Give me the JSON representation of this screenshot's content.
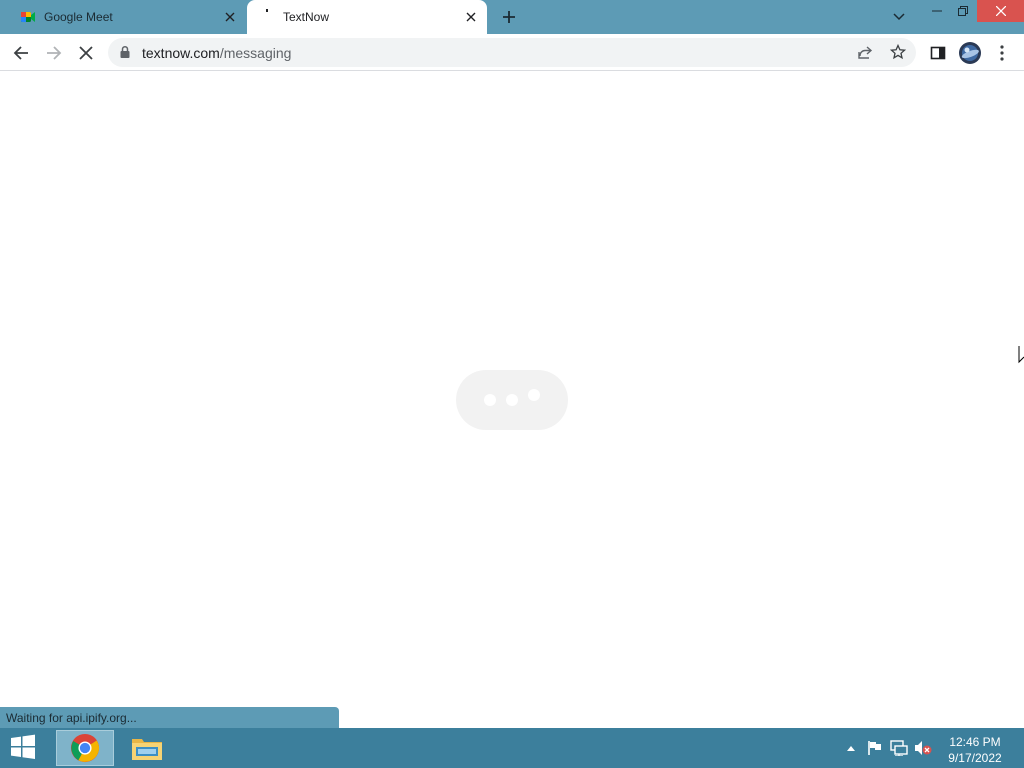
{
  "tabs": [
    {
      "title": "Google Meet",
      "active": false
    },
    {
      "title": "TextNow",
      "active": true
    }
  ],
  "address_bar": {
    "host": "textnow.com",
    "path": "/messaging"
  },
  "status": {
    "text": "Waiting for api.ipify.org..."
  },
  "taskbar": {
    "time": "12:46 PM",
    "date": "9/17/2022"
  },
  "colors": {
    "titlebar": "#5d9bb5",
    "taskbar": "#3c7f9c",
    "window_close": "#d9534f",
    "loader_bg": "#f2f2f2"
  },
  "icons": [
    "google-meet-favicon",
    "textnow-favicon",
    "close-icon",
    "plus-icon",
    "chevron-down-icon",
    "minimize-icon",
    "restore-icon",
    "back-arrow-icon",
    "forward-arrow-icon",
    "stop-loading-icon",
    "lock-icon",
    "share-icon",
    "star-icon",
    "side-panel-icon",
    "profile-avatar",
    "kebab-menu-icon",
    "windows-logo-icon",
    "chrome-icon",
    "file-explorer-icon",
    "caret-up-icon",
    "flag-icon",
    "network-icon",
    "speaker-muted-icon"
  ]
}
